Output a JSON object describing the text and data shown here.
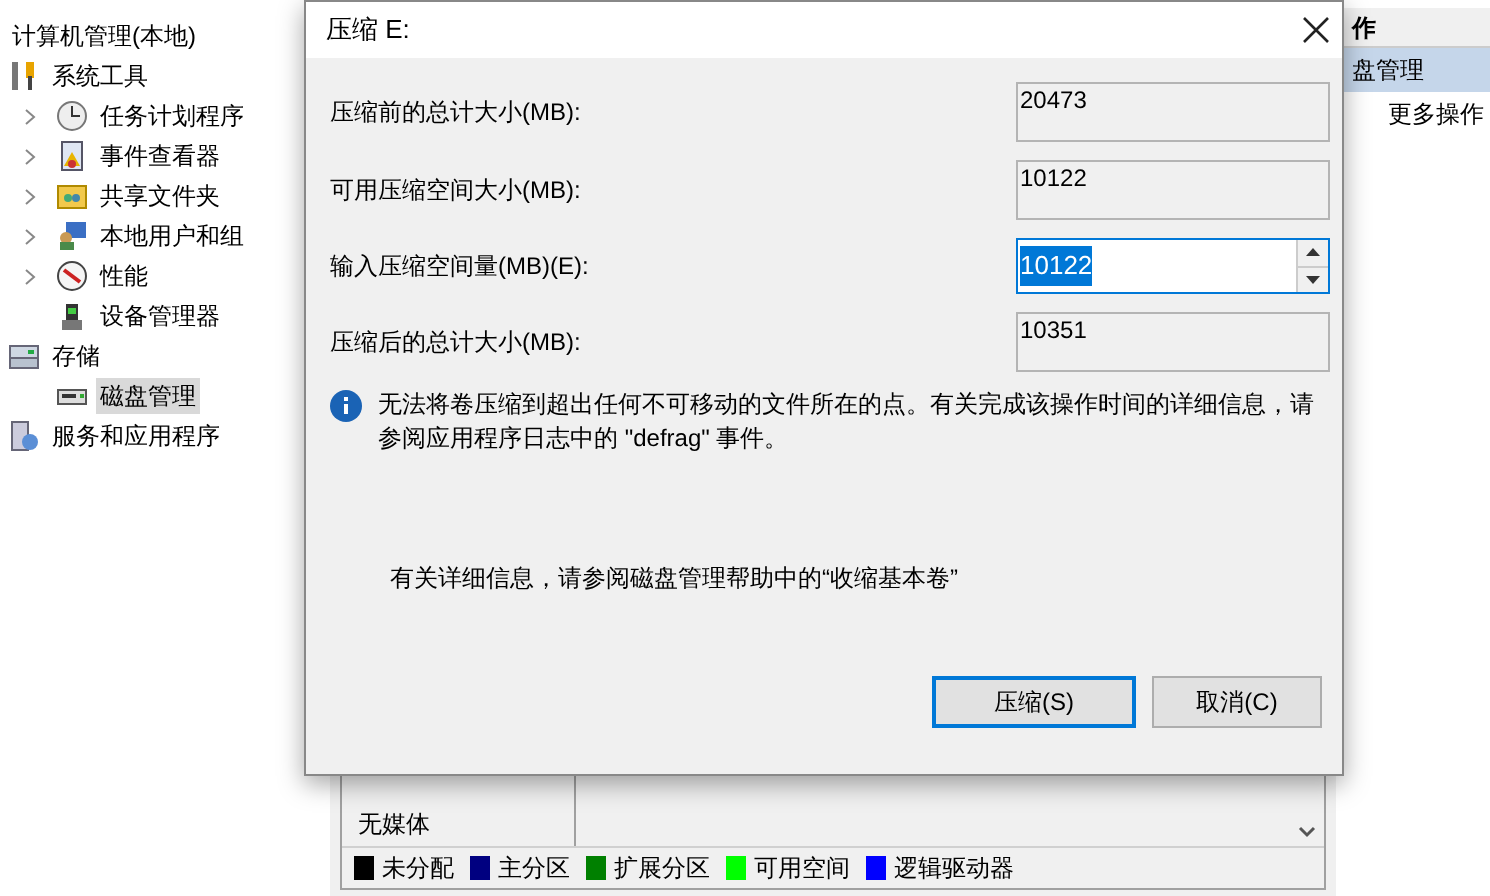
{
  "tree": {
    "label": "计算机管理(本地)",
    "children": [
      {
        "label": "系统工具",
        "selected": false,
        "children": [
          {
            "label": "任务计划程序",
            "selected": false,
            "expandable": true
          },
          {
            "label": "事件查看器",
            "selected": false,
            "expandable": true
          },
          {
            "label": "共享文件夹",
            "selected": false,
            "expandable": true
          },
          {
            "label": "本地用户和组",
            "selected": false,
            "expandable": true
          },
          {
            "label": "性能",
            "selected": false,
            "expandable": true
          },
          {
            "label": "设备管理器",
            "selected": false,
            "expandable": false
          }
        ]
      },
      {
        "label": "存储",
        "selected": false,
        "children": [
          {
            "label": "磁盘管理",
            "selected": true,
            "expandable": false
          }
        ]
      },
      {
        "label": "服务和应用程序",
        "selected": false
      }
    ]
  },
  "disk_panel": {
    "row_label": "无媒体",
    "legend": [
      {
        "label": "未分配",
        "color": "#000000"
      },
      {
        "label": "主分区",
        "color": "#000080"
      },
      {
        "label": "扩展分区",
        "color": "#008000"
      },
      {
        "label": "可用空间",
        "color": "#00ff00"
      },
      {
        "label": "逻辑驱动器",
        "color": "#0000ff"
      }
    ]
  },
  "actions": {
    "header": "作",
    "items": [
      {
        "label": "盘管理",
        "kind": "section"
      },
      {
        "label": "更多操作",
        "kind": "action"
      }
    ]
  },
  "dialog": {
    "title": "压缩 E:",
    "fields": [
      {
        "label": "压缩前的总计大小(MB):",
        "value": "20473",
        "kind": "readonly"
      },
      {
        "label": "可用压缩空间大小(MB):",
        "value": "10122",
        "kind": "readonly"
      },
      {
        "label": "输入压缩空间量(MB)(E):",
        "value": "10122",
        "kind": "spin",
        "selected": true
      },
      {
        "label": "压缩后的总计大小(MB):",
        "value": "10351",
        "kind": "readonly"
      }
    ],
    "info": "无法将卷压缩到超出任何不可移动的文件所在的点。有关完成该操作时间的详细信息，请参阅应用程序日志中的 \"defrag\" 事件。",
    "help": "有关详细信息，请参阅磁盘管理帮助中的“收缩基本卷”",
    "buttons": [
      {
        "label": "压缩(S)",
        "default": true
      },
      {
        "label": "取消(C)",
        "default": false
      }
    ]
  }
}
